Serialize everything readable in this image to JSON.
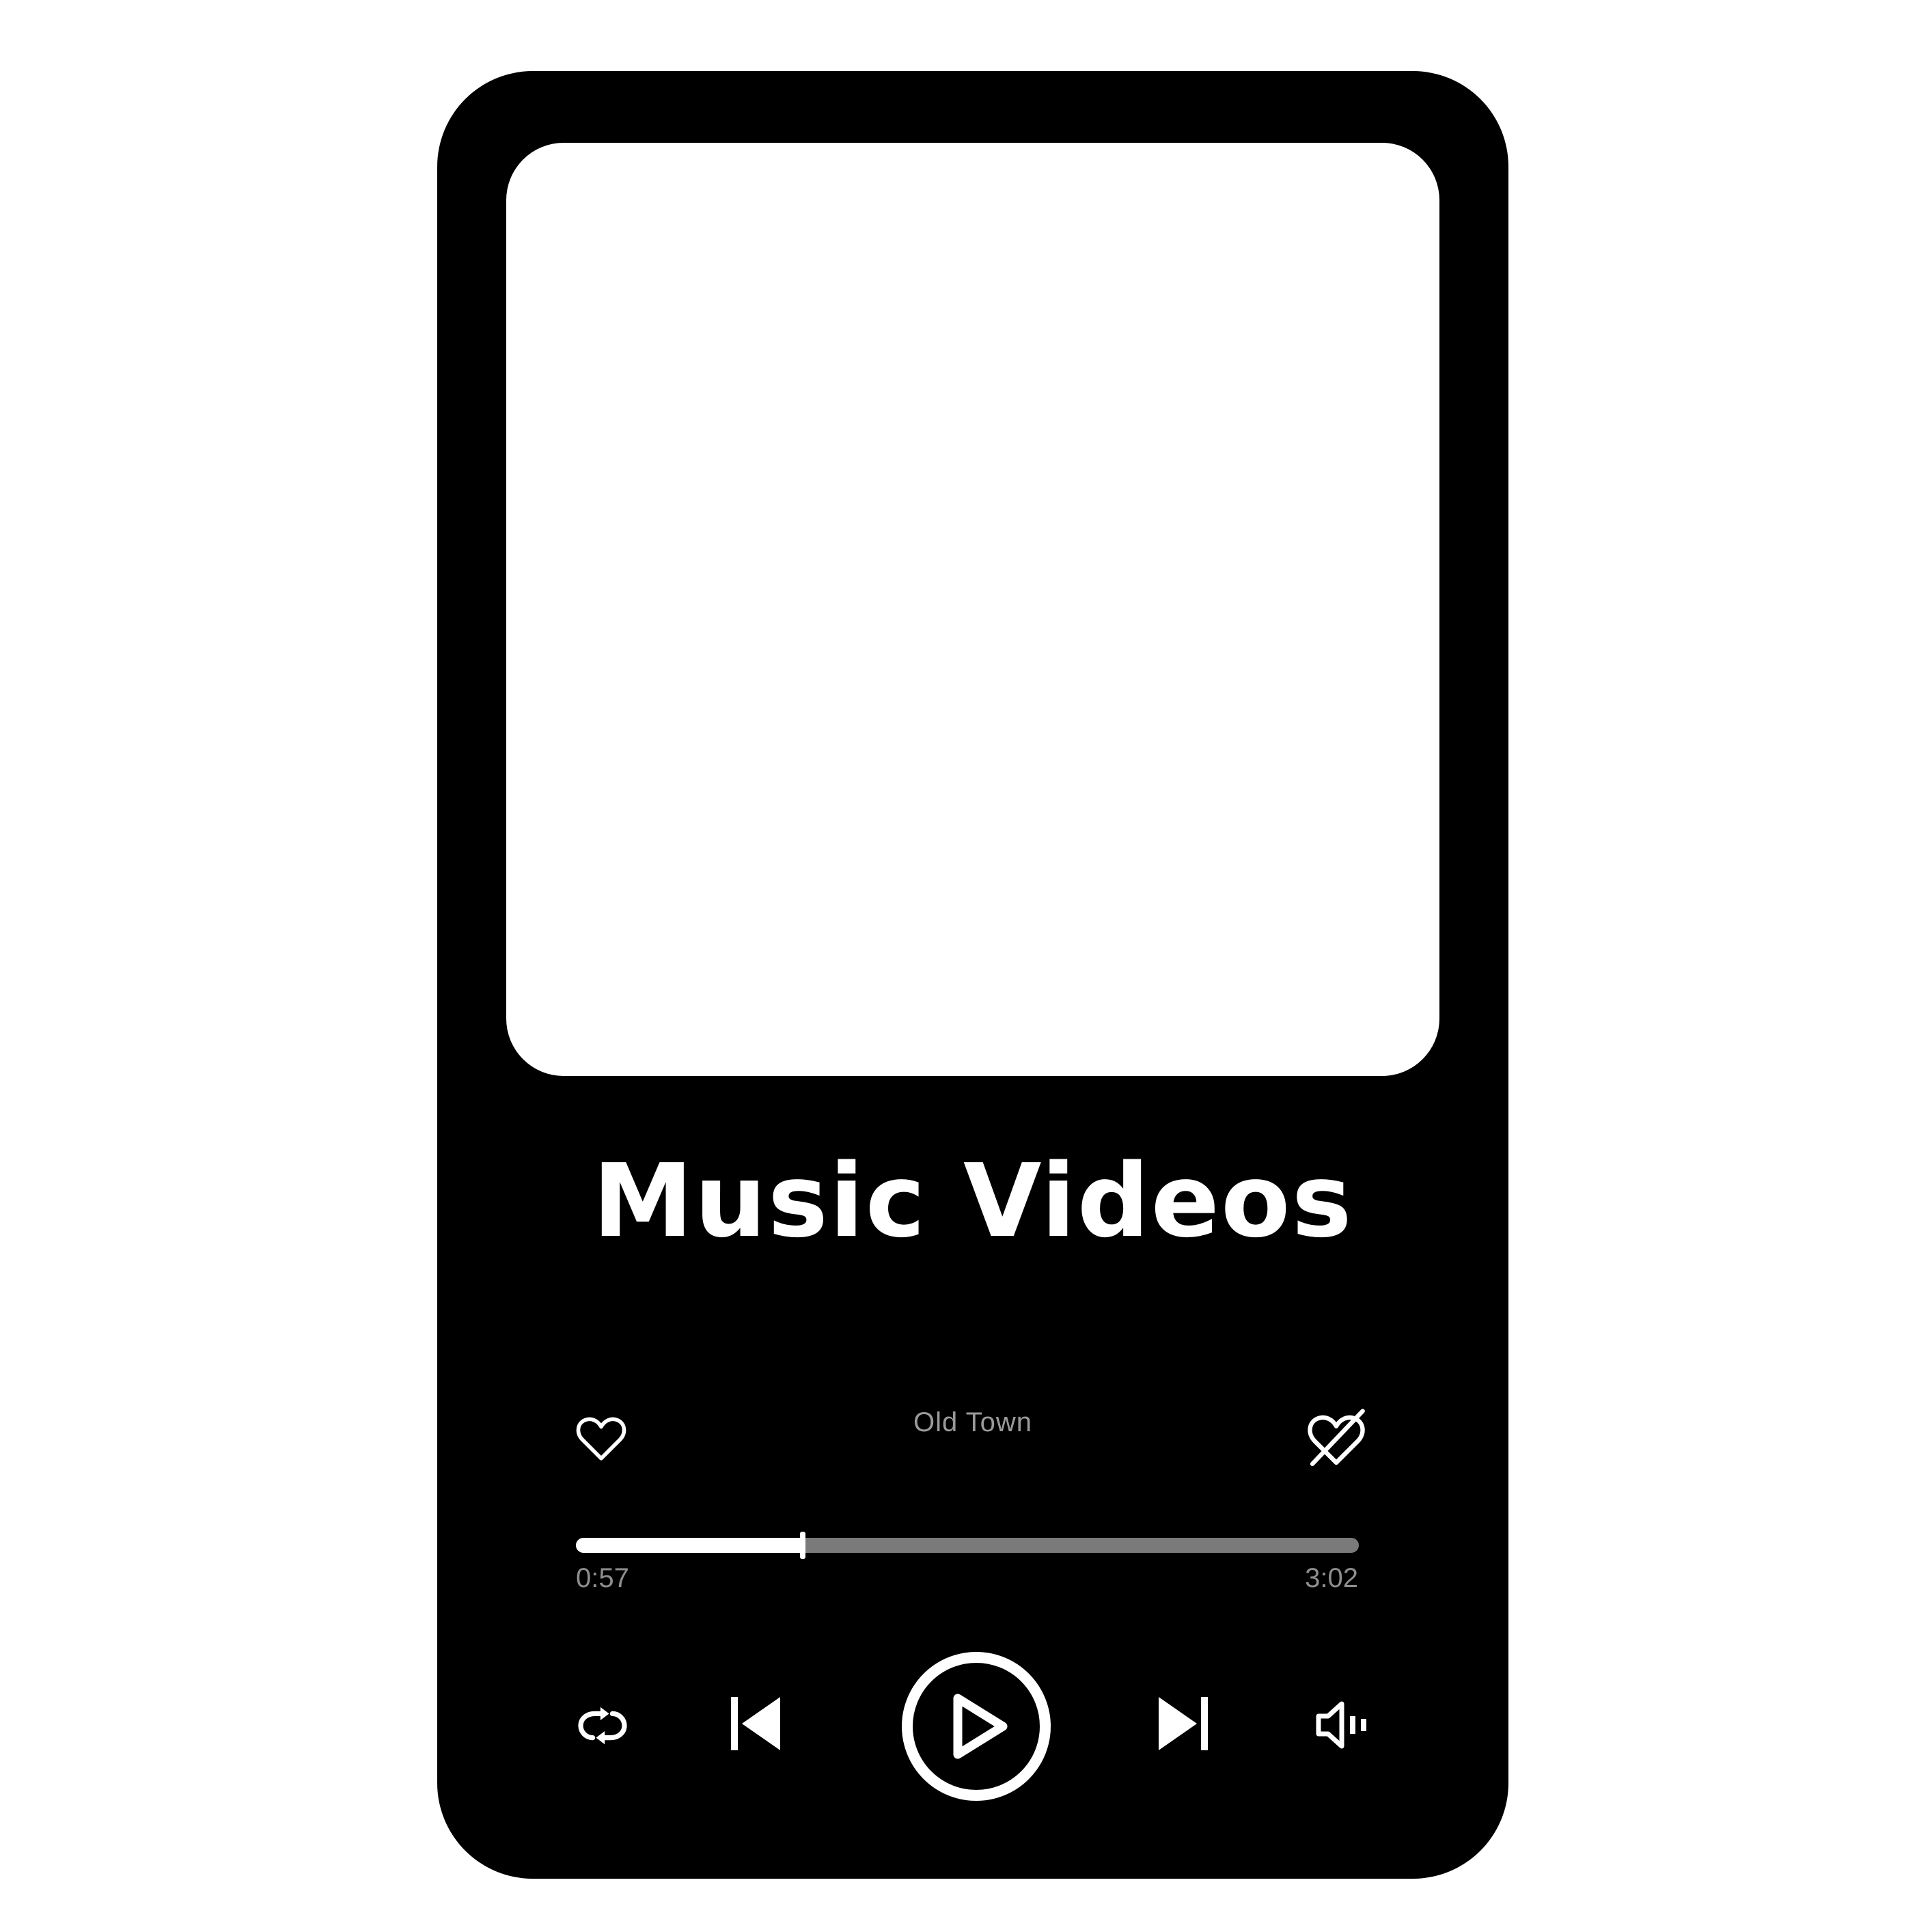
{
  "player": {
    "title": "Music Videos",
    "song": "Old Town",
    "time_elapsed": "0:57",
    "time_total": "3:02",
    "progress": 0.29
  },
  "icons": {
    "like": "heart-icon",
    "dislike": "heart-crossed-icon",
    "repeat": "repeat-icon",
    "previous": "skip-previous-icon",
    "play": "play-icon",
    "next": "skip-next-icon",
    "volume": "volume-icon"
  },
  "colors": {
    "device": "#000000",
    "screen": "#ffffff",
    "text": "#ffffff",
    "muted_text": "#9a9a9a",
    "track": "#7a7a7a"
  }
}
